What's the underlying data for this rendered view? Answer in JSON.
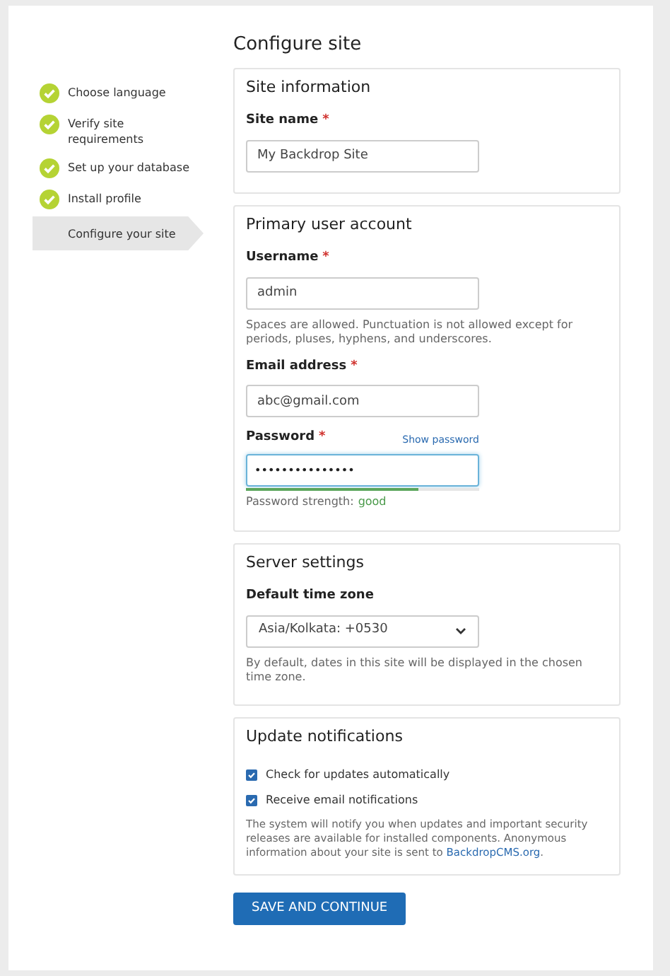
{
  "title": "Configure site",
  "steps": [
    {
      "label": "Choose language",
      "done": true,
      "selected": false
    },
    {
      "label": "Verify site requirements",
      "done": true,
      "selected": false
    },
    {
      "label": "Set up your database",
      "done": true,
      "selected": false
    },
    {
      "label": "Install profile",
      "done": true,
      "selected": false
    },
    {
      "label": "Configure your site",
      "done": false,
      "selected": true
    }
  ],
  "sections": [
    {
      "title": "Site information",
      "fields": [
        {
          "kind": "text",
          "label": "Site name",
          "required": "*",
          "value": "My Backdrop Site"
        }
      ]
    },
    {
      "title": "Primary user account",
      "fields": [
        {
          "kind": "text",
          "label": "Username",
          "required": "*",
          "value": "admin",
          "help": "Spaces are allowed. Punctuation is not allowed except for periods, pluses, hyphens, and underscores."
        },
        {
          "kind": "text",
          "label": "Email address",
          "required": "*",
          "value": "abc@gmail.com"
        },
        {
          "kind": "password",
          "label": "Password",
          "required": "*",
          "value": "•••••••••••••••",
          "focused": true,
          "toggle": "Show password",
          "strength_label": "Password strength:",
          "strength": "good",
          "level": 0.74
        }
      ]
    },
    {
      "title": "Server settings",
      "fields": [
        {
          "kind": "select",
          "label": "Default time zone",
          "value": "Asia/Kolkata: +0530",
          "help": "By default, dates in this site will be displayed in the chosen time zone."
        }
      ]
    },
    {
      "title": "Update notifications",
      "fields": [
        {
          "kind": "checkbox",
          "label": "Check for updates automatically",
          "checked": true
        },
        {
          "kind": "checkbox",
          "label": "Receive email notifications",
          "checked": true
        },
        {
          "kind": "note",
          "text": "The system will notify you when updates and important security releases are available for installed components. Anonymous information about your site is sent to",
          "link": "BackdropCMS.org",
          "after": "."
        }
      ]
    }
  ],
  "submit": "SAVE AND CONTINUE"
}
